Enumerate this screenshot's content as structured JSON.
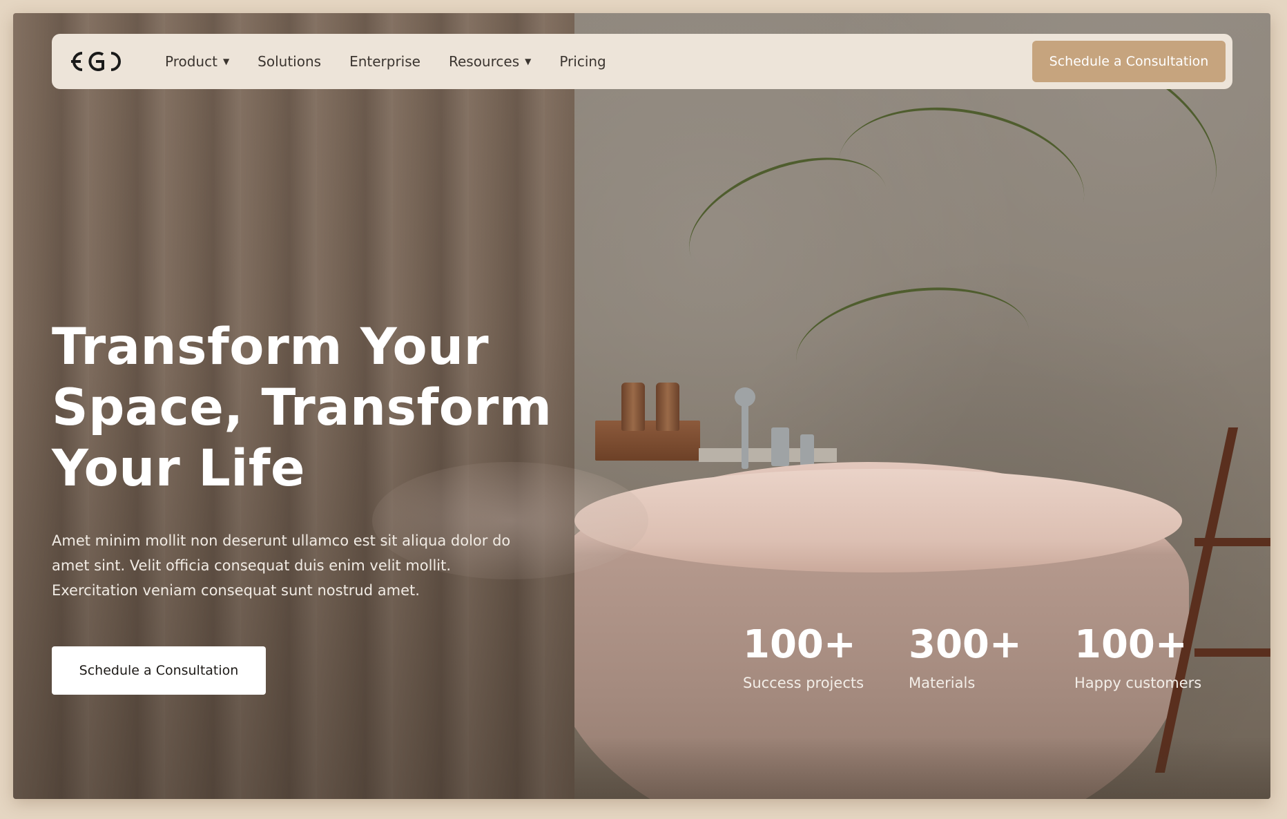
{
  "brand": {
    "logo_text": "EGD"
  },
  "nav": {
    "items": [
      {
        "label": "Product",
        "has_dropdown": true
      },
      {
        "label": "Solutions",
        "has_dropdown": false
      },
      {
        "label": "Enterprise",
        "has_dropdown": false
      },
      {
        "label": "Resources",
        "has_dropdown": true
      },
      {
        "label": "Pricing",
        "has_dropdown": false
      }
    ],
    "caret": "▼",
    "cta_label": "Schedule a Consultation"
  },
  "hero": {
    "title_lines": [
      "Transform Your",
      "Space, Transform",
      "Your Life"
    ],
    "subtitle_lines": [
      "Amet minim mollit non deserunt ullamco est sit aliqua dolor do",
      "amet sint. Velit officia consequat duis enim velit mollit.",
      "Exercitation veniam consequat sunt nostrud amet."
    ],
    "cta_label": "Schedule a Consultation"
  },
  "stats": [
    {
      "value": "100+",
      "label": "Success projects"
    },
    {
      "value": "300+",
      "label": "Materials"
    },
    {
      "value": "100+",
      "label": "Happy customers"
    }
  ],
  "colors": {
    "page_bg": "#e5d6c2",
    "nav_bg": "#ede4d9",
    "accent": "#c6a47e",
    "text_dark": "#3b3530"
  }
}
